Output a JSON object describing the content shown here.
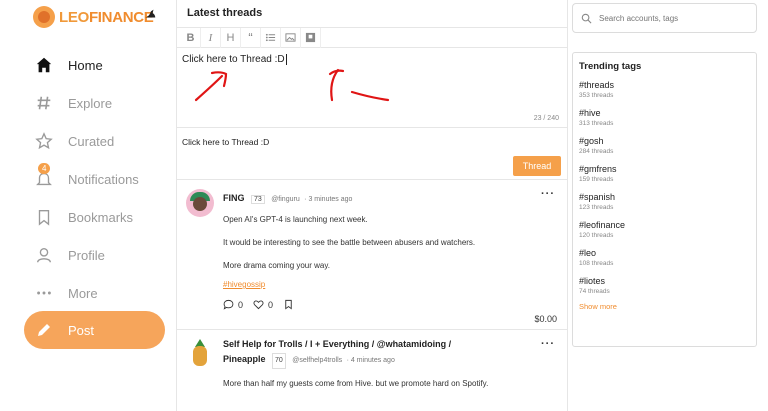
{
  "brand": {
    "logo_text_a": "LEO",
    "logo_text_b": "FINANCE"
  },
  "nav": {
    "items": [
      {
        "label": "Home",
        "icon": "home-icon",
        "active": true
      },
      {
        "label": "Explore",
        "icon": "hashtag-icon"
      },
      {
        "label": "Curated",
        "icon": "star-icon"
      },
      {
        "label": "Notifications",
        "icon": "bell-icon",
        "badge": "4"
      },
      {
        "label": "Bookmarks",
        "icon": "bookmark-icon"
      },
      {
        "label": "Profile",
        "icon": "user-icon"
      },
      {
        "label": "More",
        "icon": "ellipsis-icon"
      }
    ],
    "post_label": "Post"
  },
  "feed": {
    "title": "Latest threads",
    "toolbar": [
      "B",
      "I",
      "H",
      "“",
      "list",
      "image",
      "upload"
    ],
    "editor_text": "Click here to Thread :D",
    "char_count": "23 / 240",
    "preview_text": "Click here to Thread :D",
    "thread_button": "Thread",
    "posts": [
      {
        "author": "FING",
        "reputation": "73",
        "handle": "@finguru",
        "time": "3 minutes ago",
        "lines": [
          "Open AI's GPT-4 is launching next week.",
          "It would be interesting to see the battle between abusers and watchers.",
          "More drama coming your way."
        ],
        "tag": "#hivegossip",
        "replies": "0",
        "likes": "0",
        "payout": "$0.00"
      },
      {
        "title_line1": "Self Help for Trolls / I + Everything / @whatamidoing /",
        "title_line2": "Pineapple",
        "reputation": "70",
        "handle": "@selfhelp4trolls",
        "time": "4 minutes ago",
        "line": "More than half my guests come from Hive. but we promote hard on Spotify."
      }
    ]
  },
  "sidebar": {
    "search_placeholder": "Search accounts, tags",
    "trending_title": "Trending tags",
    "tags": [
      {
        "tag": "#threads",
        "count": "353 threads"
      },
      {
        "tag": "#hive",
        "count": "313 threads"
      },
      {
        "tag": "#gosh",
        "count": "284 threads"
      },
      {
        "tag": "#gmfrens",
        "count": "159 threads"
      },
      {
        "tag": "#spanish",
        "count": "123 threads"
      },
      {
        "tag": "#leofinance",
        "count": "120 threads"
      },
      {
        "tag": "#leo",
        "count": "108 threads"
      },
      {
        "tag": "#liotes",
        "count": "74 threads"
      }
    ],
    "show_more": "Show more"
  },
  "colors": {
    "accent": "#f5a04a",
    "annotation": "#e01515"
  }
}
